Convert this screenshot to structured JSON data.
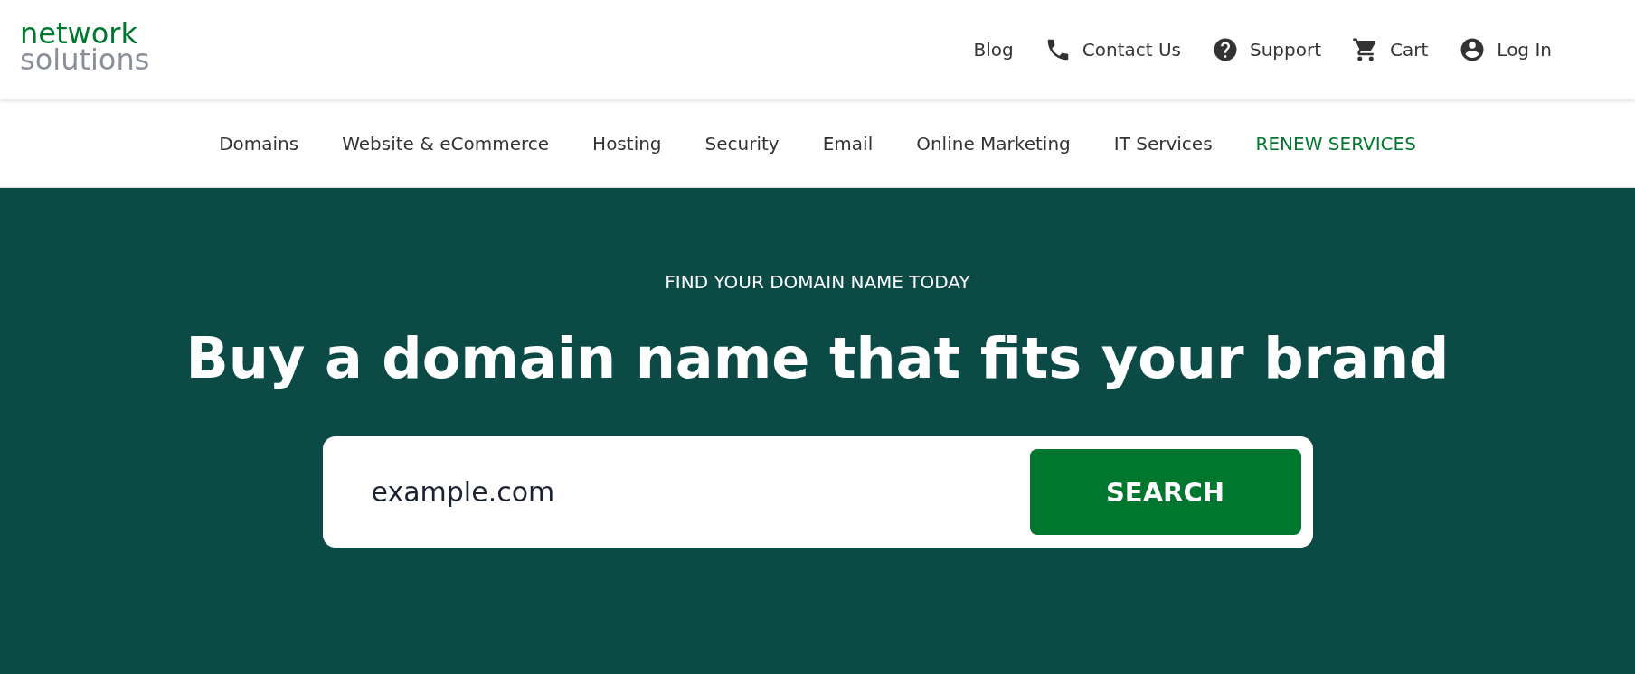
{
  "logo": {
    "line_1": "network",
    "line_2": "solutions"
  },
  "utility_links": [
    {
      "label": "Blog",
      "kind": "text"
    },
    {
      "label": "Contact Us",
      "kind": "phone"
    },
    {
      "label": "Support",
      "kind": "help"
    },
    {
      "label": "Cart",
      "kind": "cart"
    },
    {
      "label": "Log In",
      "kind": "account"
    }
  ],
  "nav": [
    {
      "label": "Domains",
      "kind": "link"
    },
    {
      "label": "Website & eCommerce",
      "kind": "link"
    },
    {
      "label": "Hosting",
      "kind": "link"
    },
    {
      "label": "Security",
      "kind": "link"
    },
    {
      "label": "Email",
      "kind": "link"
    },
    {
      "label": "Online Marketing",
      "kind": "link"
    },
    {
      "label": "IT Services",
      "kind": "link"
    },
    {
      "label": "RENEW SERVICES",
      "kind": "accent"
    }
  ],
  "hero": {
    "kicker": "FIND YOUR DOMAIN NAME TODAY",
    "heading": "Buy a domain name that fits your brand",
    "search": {
      "value": "example.com",
      "button": "SEARCH"
    }
  }
}
